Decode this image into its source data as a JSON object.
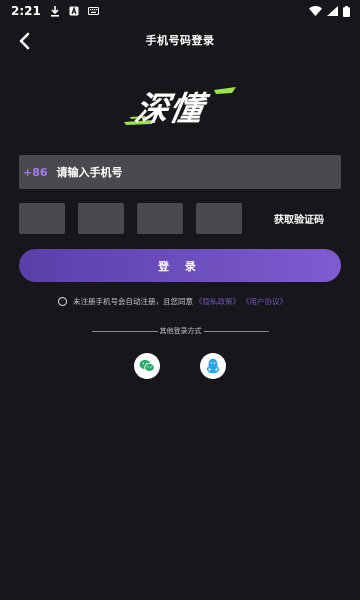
{
  "status_bar": {
    "time": "2:21",
    "icons": [
      "download-icon",
      "a-icon",
      "keyboard-icon",
      "wifi-icon",
      "signal-icon",
      "battery-icon"
    ]
  },
  "header": {
    "title": "手机号码登录",
    "back_icon": "chevron-left-icon"
  },
  "logo": {
    "text": "深懂",
    "accent_color": "#9be34a"
  },
  "phone": {
    "country_code": "+86",
    "placeholder": "请输入手机号"
  },
  "verification": {
    "box_count": 4,
    "get_code_label": "获取验证码"
  },
  "login": {
    "label": "登 录",
    "gradient": [
      "#5a3fa8",
      "#7f5cd1"
    ]
  },
  "agreement": {
    "text": "未注册手机号会自动注册，且您同意",
    "privacy": "《隐私政策》",
    "terms": "《用户协议》"
  },
  "other_login": {
    "label": "其他登录方式",
    "options": [
      {
        "icon": "wechat-icon",
        "color": "#2aae67"
      },
      {
        "icon": "qq-icon",
        "color": "#27a6e6"
      }
    ]
  },
  "colors": {
    "background": "#17161b",
    "field": "#4a4a4e",
    "accent_purple": "#a77af1"
  }
}
